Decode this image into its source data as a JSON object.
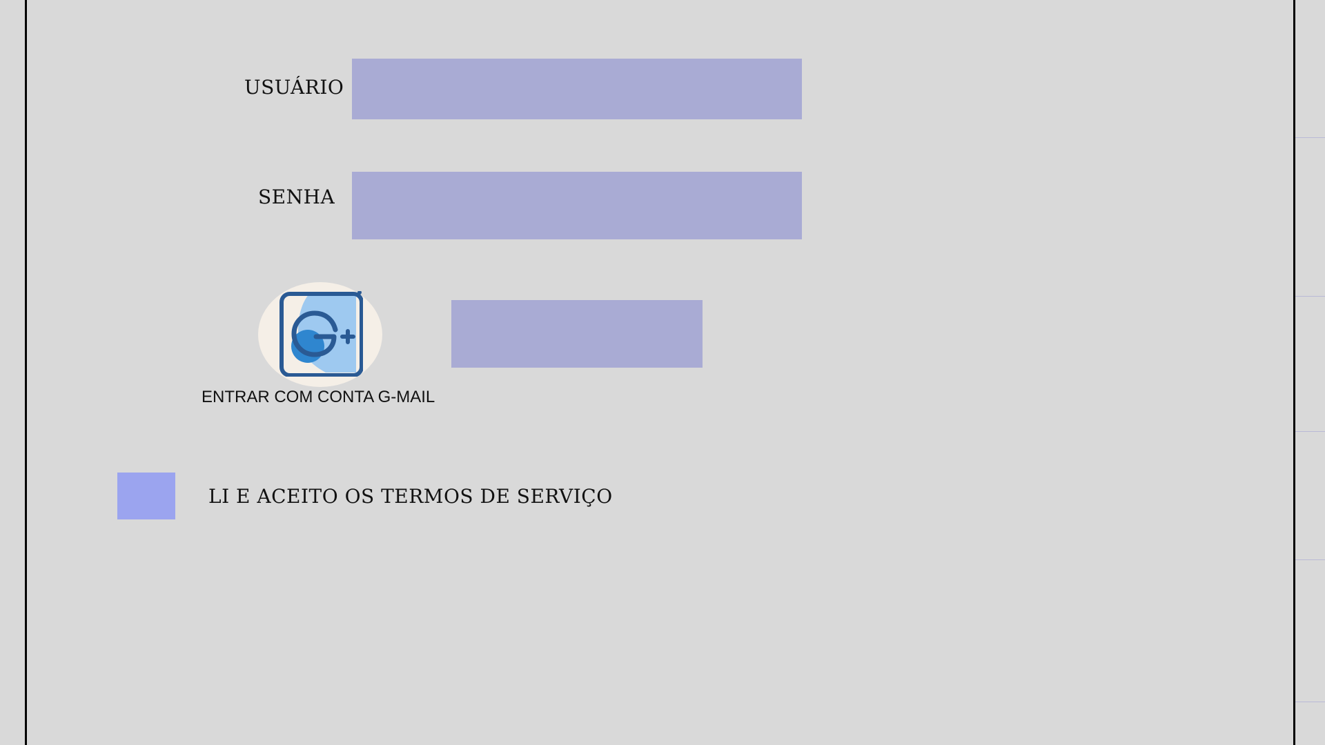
{
  "form": {
    "username_label": "USUÁRIO",
    "username_value": "",
    "password_label": "SENHA",
    "password_value": "",
    "login_button_label": "",
    "google_login_label": "ENTRAR COM CONTA G-MAIL",
    "terms_label": "LI E ACEITO OS TERMOS DE SERVIÇO",
    "terms_checked": false
  },
  "icons": {
    "google_button_icon": "google-plus-icon"
  },
  "colors": {
    "background": "#d9d9d9",
    "field": "#a9abd4",
    "checkbox": "#9ba4ef",
    "google_badge": "#f5efe7",
    "google_icon_outline": "#2a5a94",
    "google_icon_fill": "#9ec9f0",
    "google_icon_accent": "#2f86cf"
  }
}
